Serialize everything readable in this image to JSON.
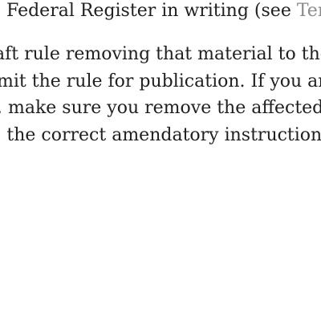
{
  "document": {
    "line1_text": "e Federal Register in writing (see ",
    "line1_link": "Ter",
    "line2": "aft rule removing that material to the",
    "line3": "mit the rule for publication.  If you ar",
    "line4": ", make sure you remove the affected",
    "line5": "; the correct amendatory instructions"
  },
  "colors": {
    "text": "#1f1f1f",
    "link": "#8a8a8a",
    "background": "#ffffff"
  }
}
